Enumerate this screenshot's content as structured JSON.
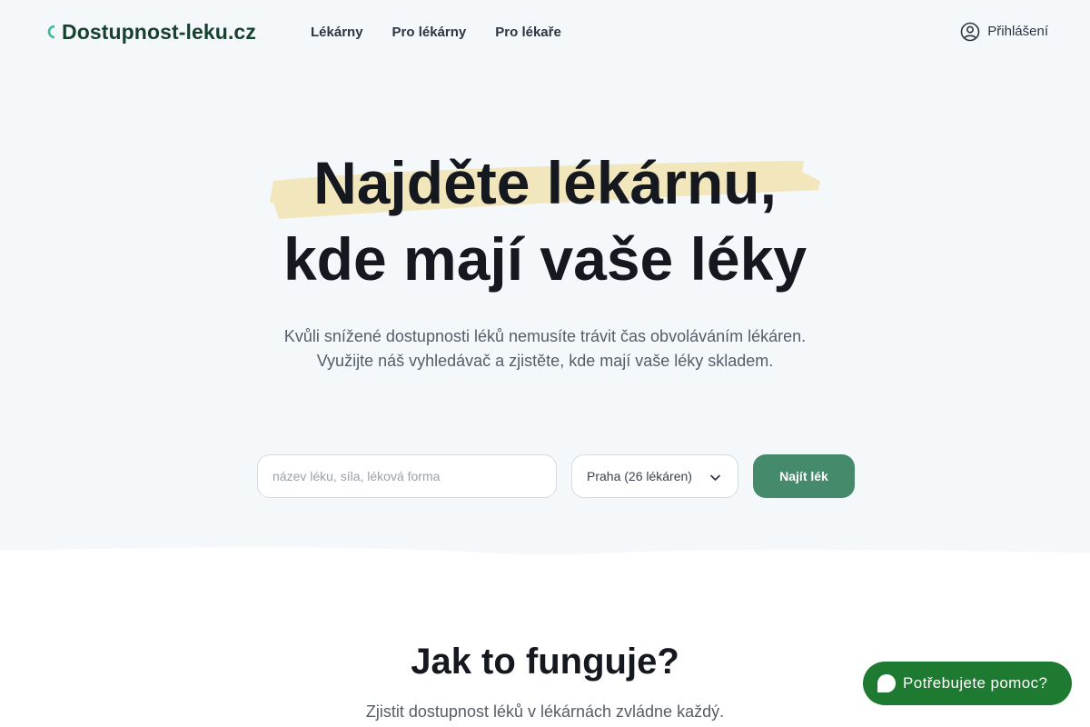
{
  "header": {
    "logo_text": "Dostupnost-leku.cz",
    "nav": [
      {
        "label": "Lékárny"
      },
      {
        "label": "Pro lékárny"
      },
      {
        "label": "Pro lékaře"
      }
    ],
    "login_label": "Přihlášení"
  },
  "hero": {
    "title_line1": "Najděte lékárnu,",
    "title_line2": "kde mají vaše léky",
    "subtitle_line1": "Kvůli snížené dostupnosti léků nemusíte trávit čas obvoláváním lékáren.",
    "subtitle_line2": "Využijte náš vyhledávač a zjistěte, kde mají vaše léky skladem."
  },
  "search": {
    "placeholder": "název léku, síla, léková forma",
    "value": "",
    "city_selected": "Praha (26 lékáren)",
    "submit_label": "Najít lék"
  },
  "how_it_works": {
    "title": "Jak to funguje?",
    "subtitle": "Zjistit dostupnost léků v lékárnách zvládne každý."
  },
  "help": {
    "label": "Potřebujete pomoc?"
  },
  "colors": {
    "brand_dark": "#17402f",
    "accent_teal": "#3ab9a0",
    "button_green": "#468a6c",
    "help_green": "#1e7a31",
    "highlight": "#f2e6bd",
    "hero_bg": "#f5f8fb"
  },
  "icons": {
    "login": "user-circle-icon",
    "select": "chevron-down-icon",
    "help": "chat-bubble-icon",
    "logo": "pill-icon"
  }
}
